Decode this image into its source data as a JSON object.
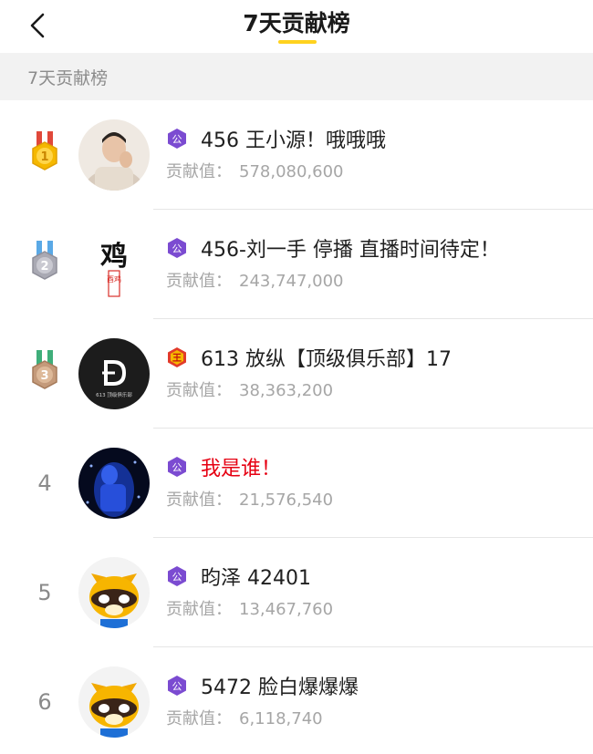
{
  "header": {
    "title": "7天贡献榜"
  },
  "section": {
    "label": "7天贡献榜"
  },
  "value_label": "贡献值：",
  "rows": [
    {
      "rank": "1",
      "name": "456 王小源！哦哦哦",
      "value": "578,080,600",
      "badge_char": "公",
      "avatar_text": ""
    },
    {
      "rank": "2",
      "name": "456-刘一手 停播 直播时间待定！",
      "value": "243,747,000",
      "badge_char": "公",
      "avatar_text": "鸡",
      "avatar_sub": "酉鸡"
    },
    {
      "rank": "3",
      "name": "613 放纵【顶级俱乐部】17",
      "value": "38,363,200",
      "badge_char": "王",
      "avatar_text": "613 顶级俱乐部"
    },
    {
      "rank": "4",
      "name": "我是谁！",
      "value": "21,576,540",
      "badge_char": "公",
      "avatar_text": ""
    },
    {
      "rank": "5",
      "name": "昀泽 42401",
      "value": "13,467,760",
      "badge_char": "公",
      "avatar_text": ""
    },
    {
      "rank": "6",
      "name": "5472 脸白爆爆爆",
      "value": "6,118,740",
      "badge_char": "公",
      "avatar_text": ""
    }
  ],
  "colors": {
    "accent": "#ffd21f",
    "gold": "#f5b800",
    "silver": "#a9a9b3",
    "bronze": "#b98a6a",
    "badge_purple": "#7b4bd1",
    "badge_red": "#e23b2a",
    "highlight_name": "#e60012"
  },
  "icons": {
    "back": "chevron-left-icon",
    "medal_1": "gold-medal-icon",
    "medal_2": "silver-medal-icon",
    "medal_3": "bronze-medal-icon",
    "badge": "level-badge-icon"
  }
}
